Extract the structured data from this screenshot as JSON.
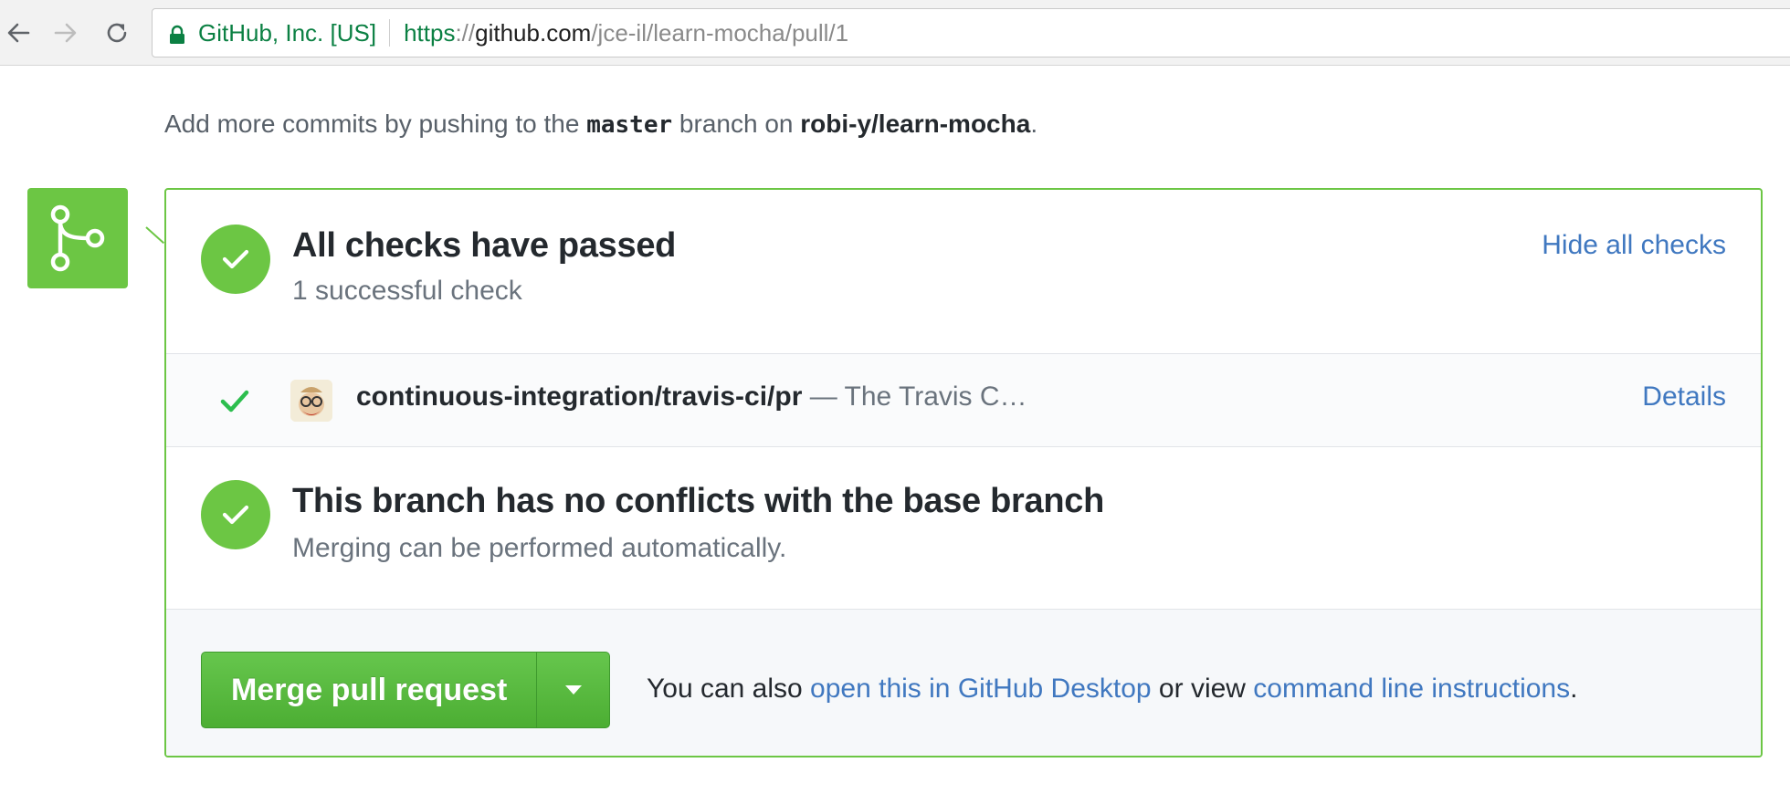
{
  "browser": {
    "security_label": "GitHub, Inc. [US]",
    "url_scheme": "https",
    "url_separator": "://",
    "url_host": "github.com",
    "url_path": "/jce-il/learn-mocha/pull/1"
  },
  "info": {
    "prefix": "Add more commits by pushing to the ",
    "branch": "master",
    "middle": " branch on ",
    "repo": "robi-y/learn-mocha",
    "suffix": "."
  },
  "checks": {
    "heading": "All checks have passed",
    "subtext": "1 successful check",
    "toggle_label": "Hide all checks",
    "items": [
      {
        "context": "continuous-integration/travis-ci/pr",
        "description": " — The Travis C…",
        "details_label": "Details"
      }
    ]
  },
  "conflicts": {
    "heading": "This branch has no conflicts with the base branch",
    "subtext": "Merging can be performed automatically."
  },
  "merge": {
    "button_label": "Merge pull request",
    "hint_prefix": "You can also ",
    "desktop_link": "open this in GitHub Desktop",
    "hint_middle": " or view ",
    "cli_link": "command line instructions",
    "hint_suffix": "."
  },
  "colors": {
    "success": "#6cc644",
    "link": "#4078c0",
    "secure": "#0b8043"
  }
}
